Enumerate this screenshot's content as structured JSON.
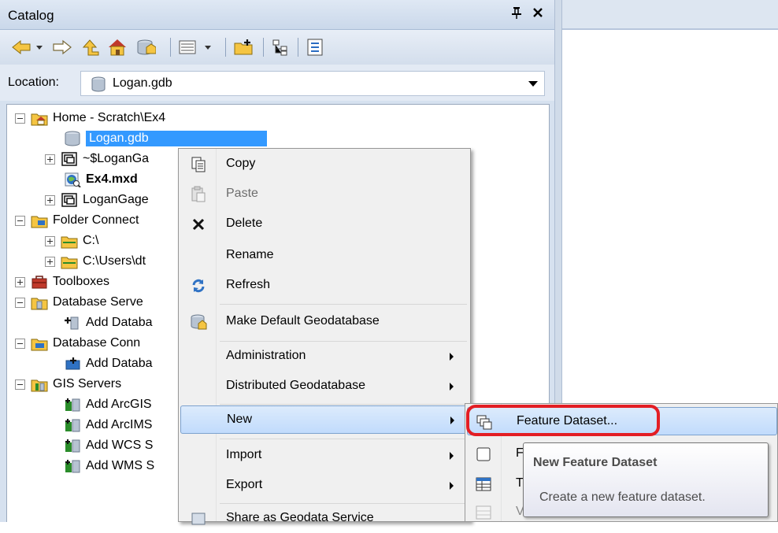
{
  "catalog": {
    "title": "Catalog",
    "pin_glyph": "ᴪ",
    "close_glyph": "✕"
  },
  "toolbar": {
    "icons": [
      "back-arrow-icon",
      "forward-arrow-icon",
      "up-one-level-icon",
      "home-folder-icon",
      "default-geodatabase-icon",
      "view-options-icon",
      "connect-folder-icon",
      "toggle-contents-icon",
      "options-icon"
    ]
  },
  "location": {
    "label": "Location:",
    "value": "Logan.gdb"
  },
  "tree": {
    "home": "Home - Scratch\\Ex4",
    "logan_gdb": "Logan.gdb",
    "loganga_tmp": "~$LoganGa",
    "ex4_mxd": "Ex4.mxd",
    "logangage": "LoganGage",
    "folder_connections": "Folder Connect",
    "c_drive": "C:\\",
    "c_users": "C:\\Users\\dt",
    "toolboxes": "Toolboxes",
    "database_servers": "Database Serve",
    "add_database_server": "Add Databa",
    "database_connections": "Database Conn",
    "add_database_connection": "Add Databa",
    "gis_servers": "GIS Servers",
    "add_arcgis": "Add ArcGIS",
    "add_arcims": "Add ArcIMS",
    "add_wcs": "Add WCS S",
    "add_wms": "Add WMS S"
  },
  "context_menu": {
    "copy": "Copy",
    "paste": "Paste",
    "delete": "Delete",
    "rename": "Rename",
    "refresh": "Refresh",
    "make_default": "Make Default Geodatabase",
    "administration": "Administration",
    "distributed": "Distributed Geodatabase",
    "new": "New",
    "import": "Import",
    "export": "Export",
    "share": "Share as Geodata Service"
  },
  "submenu": {
    "feature_dataset": "Feature Dataset...",
    "feature_class_initial": "F",
    "table_initial": "T",
    "view_initial": "V"
  },
  "tooltip": {
    "title": "New Feature Dataset",
    "description": "Create a new feature dataset."
  },
  "colors": {
    "selection": "#3399ff",
    "highlight_circle": "#e31e24",
    "pane_background": "#d6e1ef"
  }
}
